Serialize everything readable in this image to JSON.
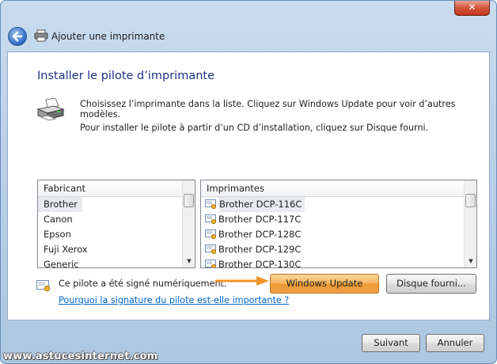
{
  "window": {
    "title": "Ajouter une imprimante",
    "close_glyph": "✕"
  },
  "heading": "Installer le pilote d’imprimante",
  "description": {
    "line1": "Choisissez l’imprimante dans la liste. Cliquez sur Windows Update pour voir d’autres modèles.",
    "line2": "Pour installer le pilote à partir d’un CD d’installation, cliquez sur Disque fourni."
  },
  "manufacturers": {
    "header": "Fabricant",
    "selected": "Brother",
    "items": [
      "Brother",
      "Canon",
      "Epson",
      "Fuji Xerox",
      "Generic"
    ]
  },
  "printers": {
    "header": "Imprimantes",
    "selected": "Brother DCP-116C",
    "items": [
      "Brother DCP-116C",
      "Brother DCP-117C",
      "Brother DCP-128C",
      "Brother DCP-129C",
      "Brother DCP-130C"
    ]
  },
  "signed_text": "Ce pilote a été signé numériquement.",
  "help_link": "Pourquoi la signature du pilote est-elle importante ?",
  "buttons": {
    "windows_update": "Windows Update",
    "have_disk": "Disque fourni...",
    "next": "Suivant",
    "cancel": "Annuler"
  },
  "watermark": "www.astucesinternet.com",
  "icons": {
    "back": "back-arrow-icon",
    "title": "printer-icon",
    "printer_large": "printer-icon",
    "driver": "driver-certificate-icon",
    "signed": "signed-certificate-icon"
  },
  "colors": {
    "heading": "#1e3287",
    "link": "#0066cc",
    "highlight_button": "#f4b45b",
    "arrow": "#f0962a"
  }
}
